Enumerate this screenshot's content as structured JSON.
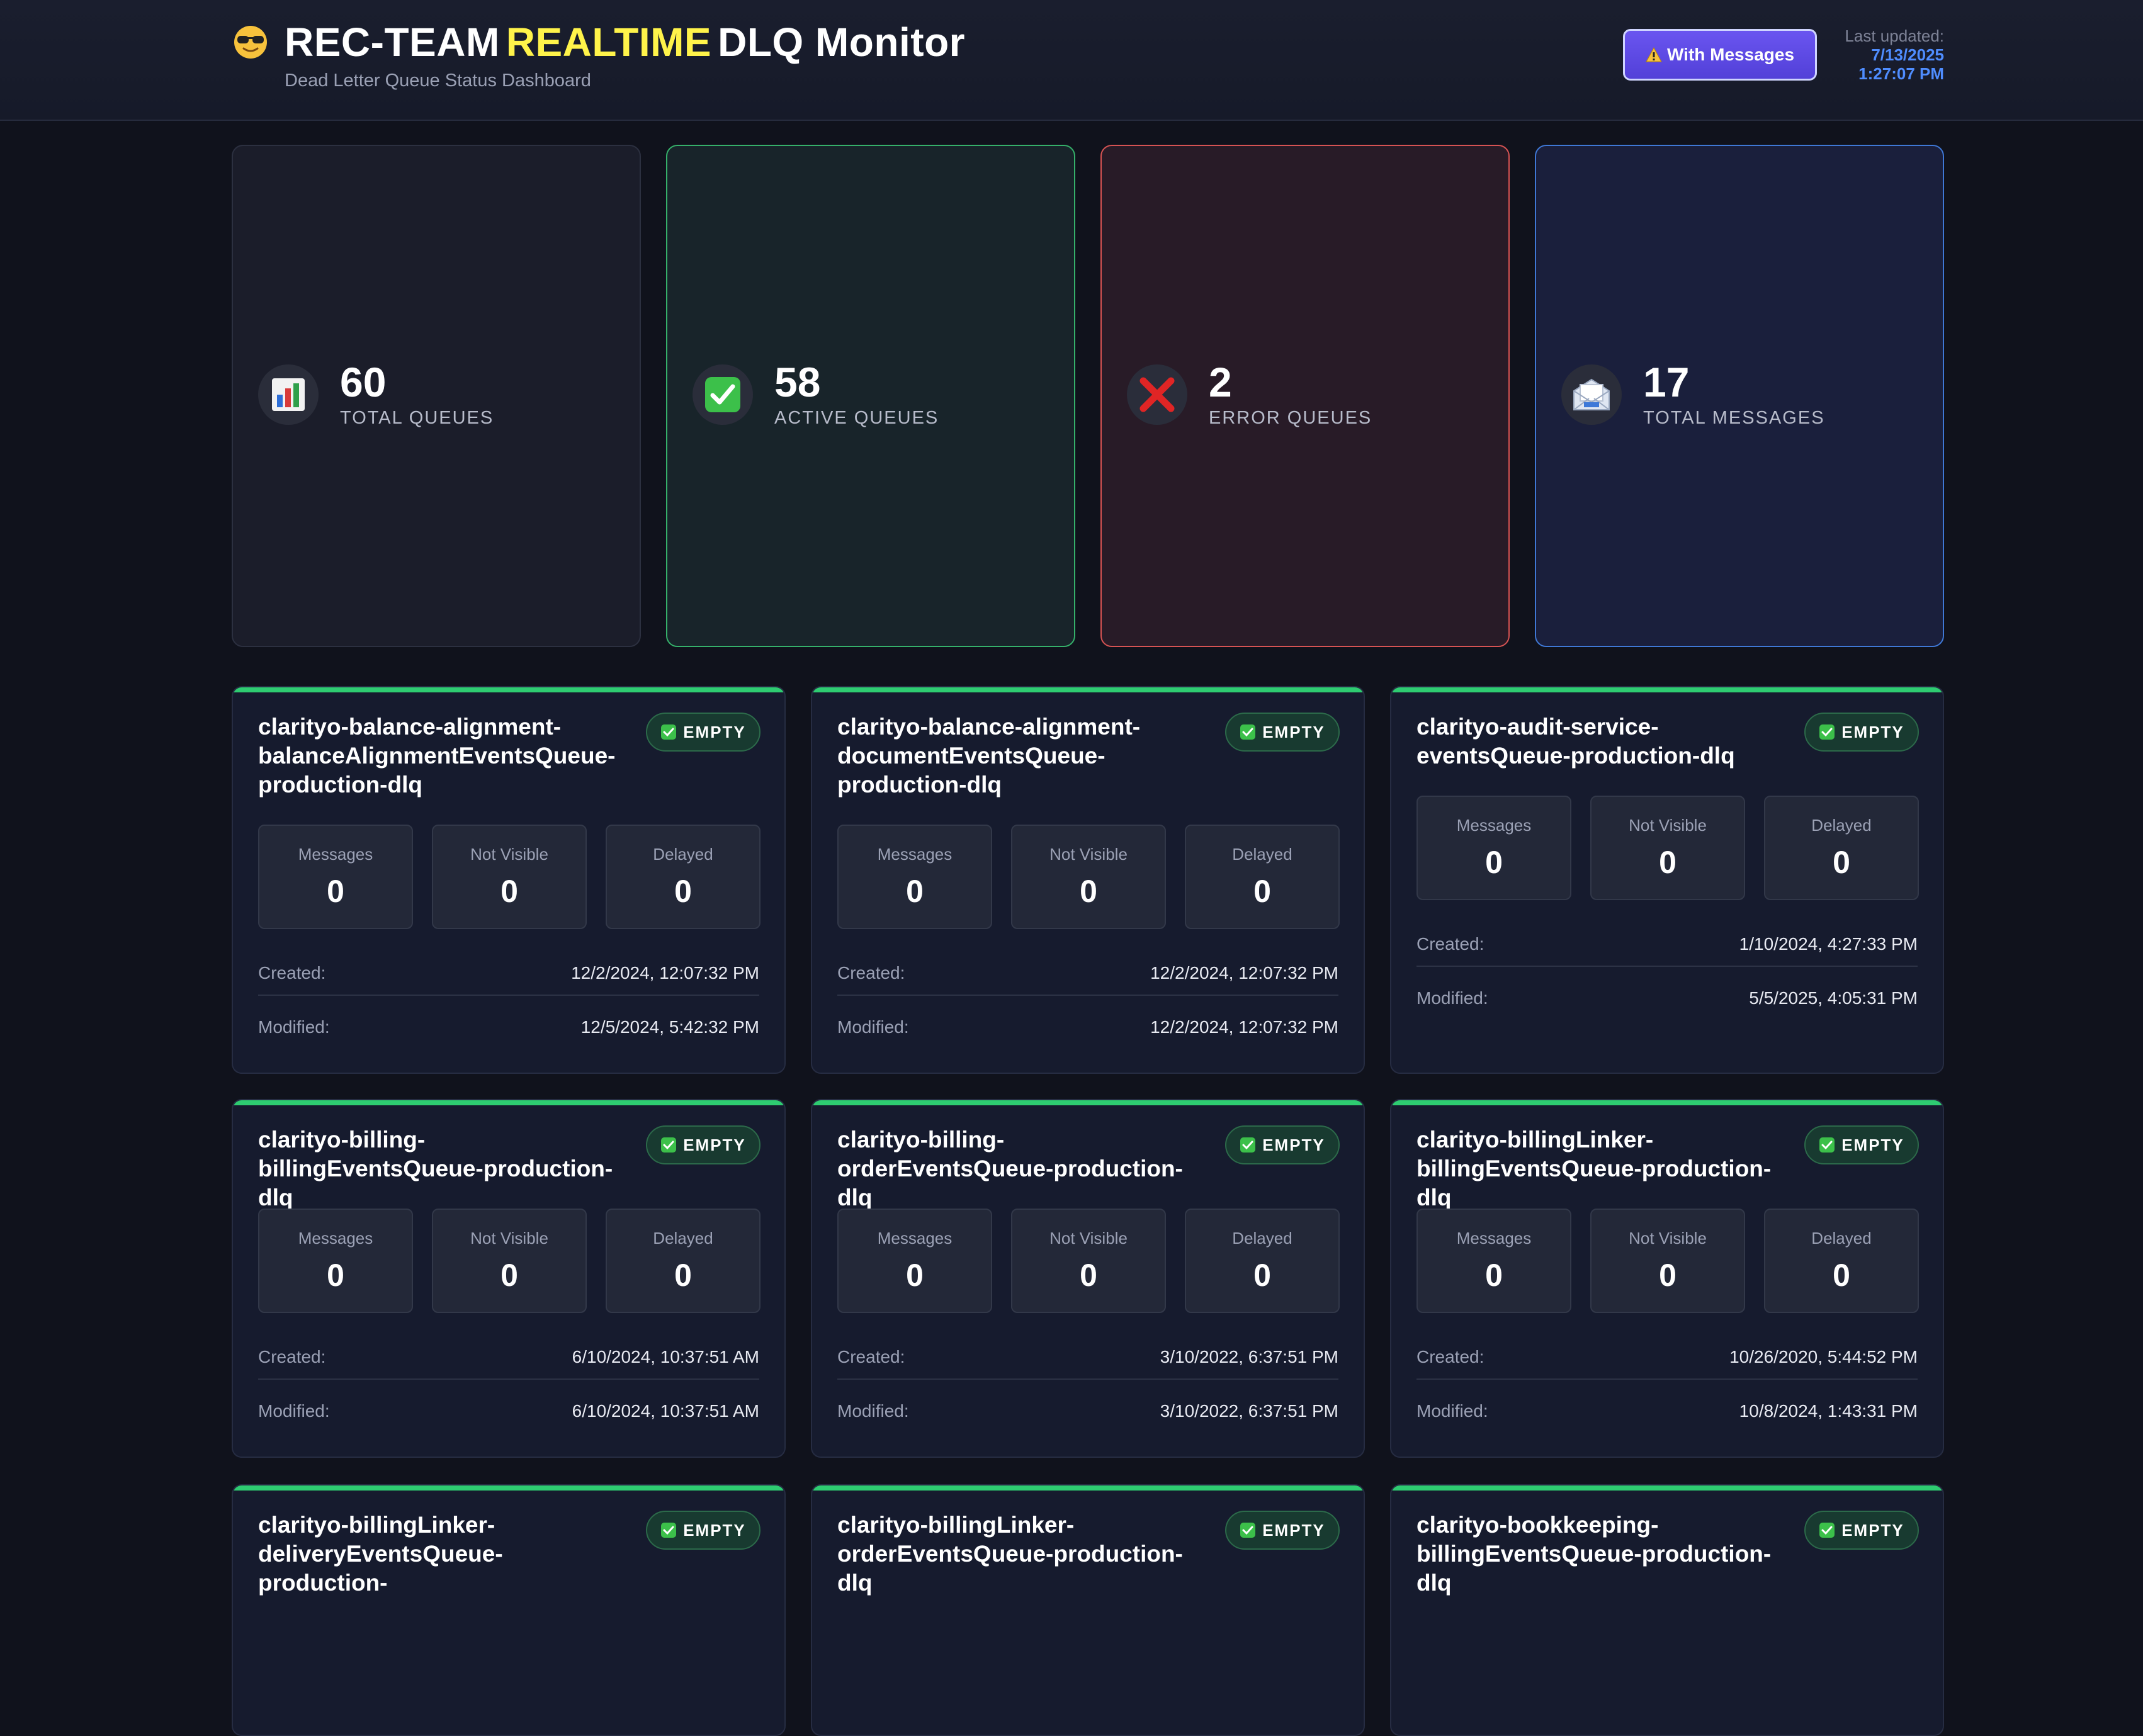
{
  "header": {
    "title_prefix": "REC-TEAM",
    "title_highlight": "REALTIME",
    "title_suffix": "DLQ Monitor",
    "subtitle": "Dead Letter Queue Status Dashboard",
    "filter_button": "With Messages",
    "last_updated_label": "Last updated:",
    "last_updated_date": "7/13/2025",
    "last_updated_time": "1:27:07 PM"
  },
  "stats": [
    {
      "value": "60",
      "label": "TOTAL QUEUES",
      "icon": "bar-chart-icon"
    },
    {
      "value": "58",
      "label": "ACTIVE QUEUES",
      "icon": "check-icon"
    },
    {
      "value": "2",
      "label": "ERROR QUEUES",
      "icon": "cross-icon"
    },
    {
      "value": "17",
      "label": "TOTAL MESSAGES",
      "icon": "envelope-icon"
    }
  ],
  "labels": {
    "messages": "Messages",
    "not_visible": "Not Visible",
    "delayed": "Delayed",
    "created": "Created:",
    "modified": "Modified:",
    "badge_empty": "EMPTY"
  },
  "queues": [
    {
      "name": "clarityo-balance-alignment-balanceAlignmentEventsQueue-production-dlq",
      "status": "EMPTY",
      "messages": "0",
      "not_visible": "0",
      "delayed": "0",
      "created": "12/2/2024, 12:07:32 PM",
      "modified": "12/5/2024, 5:42:32 PM"
    },
    {
      "name": "clarityo-balance-alignment-documentEventsQueue-production-dlq",
      "status": "EMPTY",
      "messages": "0",
      "not_visible": "0",
      "delayed": "0",
      "created": "12/2/2024, 12:07:32 PM",
      "modified": "12/2/2024, 12:07:32 PM"
    },
    {
      "name": "clarityo-audit-service-eventsQueue-production-dlq",
      "status": "EMPTY",
      "messages": "0",
      "not_visible": "0",
      "delayed": "0",
      "created": "1/10/2024, 4:27:33 PM",
      "modified": "5/5/2025, 4:05:31 PM"
    },
    {
      "name": "clarityo-billing-billingEventsQueue-production-dlq",
      "status": "EMPTY",
      "messages": "0",
      "not_visible": "0",
      "delayed": "0",
      "created": "6/10/2024, 10:37:51 AM",
      "modified": "6/10/2024, 10:37:51 AM"
    },
    {
      "name": "clarityo-billing-orderEventsQueue-production-dlq",
      "status": "EMPTY",
      "messages": "0",
      "not_visible": "0",
      "delayed": "0",
      "created": "3/10/2022, 6:37:51 PM",
      "modified": "3/10/2022, 6:37:51 PM"
    },
    {
      "name": "clarityo-billingLinker-billingEventsQueue-production-dlq",
      "status": "EMPTY",
      "messages": "0",
      "not_visible": "0",
      "delayed": "0",
      "created": "10/26/2020, 5:44:52 PM",
      "modified": "10/8/2024, 1:43:31 PM"
    },
    {
      "name": "clarityo-billingLinker-deliveryEventsQueue-production-",
      "status": "EMPTY"
    },
    {
      "name": "clarityo-billingLinker-orderEventsQueue-production-dlq",
      "status": "EMPTY"
    },
    {
      "name": "clarityo-bookkeeping-billingEventsQueue-production-dlq",
      "status": "EMPTY"
    }
  ]
}
